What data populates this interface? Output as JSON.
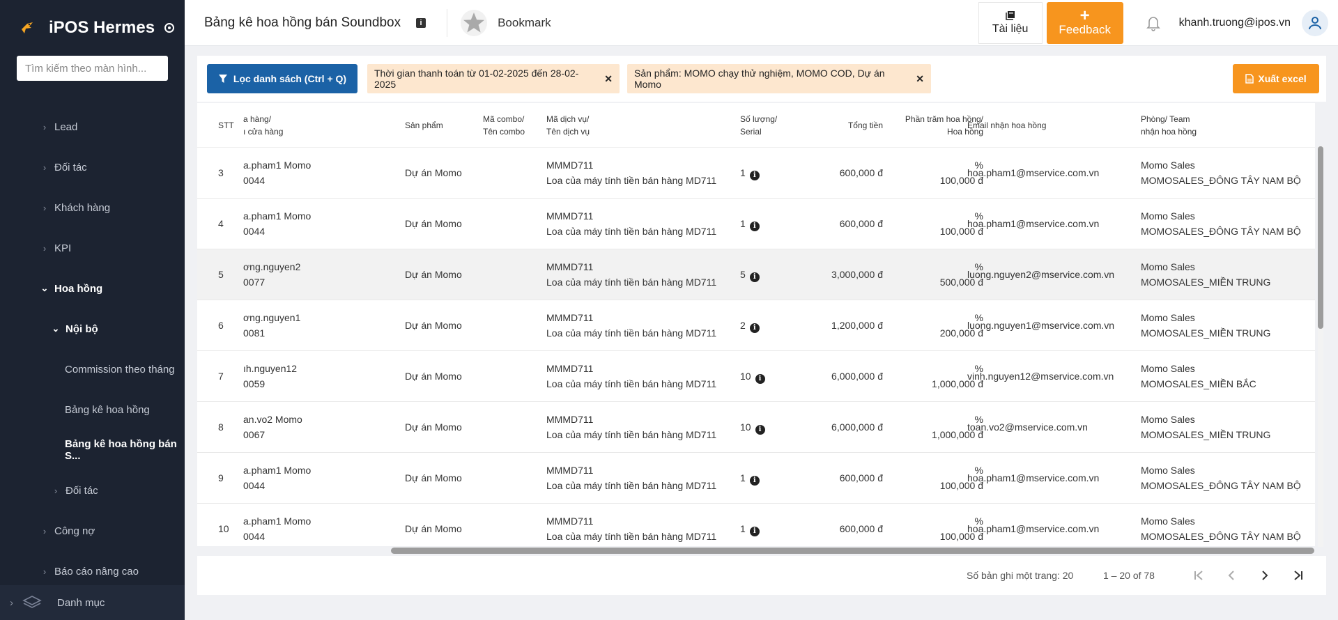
{
  "sidebar": {
    "app_name": "iPOS Hermes",
    "search_placeholder": "Tìm kiếm theo màn hình...",
    "items": [
      {
        "label": "Lead"
      },
      {
        "label": "Đối tác"
      },
      {
        "label": "Khách hàng"
      },
      {
        "label": "KPI"
      },
      {
        "label": "Hoa hồng"
      },
      {
        "label": "Nội bộ"
      },
      {
        "label": "Commission theo tháng"
      },
      {
        "label": "Bảng kê hoa hồng"
      },
      {
        "label": "Bảng kê hoa hồng bán S..."
      },
      {
        "label": "Đối tác"
      },
      {
        "label": "Công nợ"
      },
      {
        "label": "Báo cáo nâng cao"
      }
    ],
    "bottom_label": "Danh mục"
  },
  "header": {
    "title": "Bảng kê hoa hồng bán Soundbox",
    "bookmark_label": "Bookmark",
    "docs_label": "Tài liệu",
    "feedback_label": "Feedback",
    "user_email": "khanh.truong@ipos.vn"
  },
  "filters": {
    "filter_button": "Lọc danh sách (Ctrl + Q)",
    "chip_time": "Thời gian thanh toán từ 01-02-2025 đến 28-02-2025",
    "chip_product": "Sản phẩm: MOMO chạy thử nghiệm, MOMO COD, Dự án Momo",
    "export_button": "Xuất excel"
  },
  "table": {
    "headers": {
      "stt": "STT",
      "store_1": "a hàng/",
      "store_2": "ı cửa hàng",
      "product": "Sản phẩm",
      "combo_1": "Mã combo/",
      "combo_2": "Tên combo",
      "service_1": "Mã dịch vụ/",
      "service_2": "Tên dịch vụ",
      "qty_1": "Số lượng/",
      "qty_2": "Serial",
      "total": "Tổng tiền",
      "percent_1": "Phần trăm hoa hồng/",
      "percent_2": "Hoa hồng",
      "email": "Email nhận hoa hồng",
      "team_1": "Phòng/ Team",
      "team_2": "nhận hoa hồng"
    },
    "rows": [
      {
        "stt": "3",
        "store_1": "a.pham1 Momo",
        "store_2": "0044",
        "product": "Dự án Momo",
        "service_code": "MMMD711",
        "service_name": "Loa của máy tính tiền bán hàng MD711",
        "qty": "1",
        "total": "600,000 đ",
        "percent": "%",
        "commission": "100,000 đ",
        "email": "hoa.pham1@mservice.com.vn",
        "team_1": "Momo Sales",
        "team_2": "MOMOSALES_ĐÔNG TÂY NAM BỘ"
      },
      {
        "stt": "4",
        "store_1": "a.pham1 Momo",
        "store_2": "0044",
        "product": "Dự án Momo",
        "service_code": "MMMD711",
        "service_name": "Loa của máy tính tiền bán hàng MD711",
        "qty": "1",
        "total": "600,000 đ",
        "percent": "%",
        "commission": "100,000 đ",
        "email": "hoa.pham1@mservice.com.vn",
        "team_1": "Momo Sales",
        "team_2": "MOMOSALES_ĐÔNG TÂY NAM BỘ"
      },
      {
        "stt": "5",
        "store_1": "ơng.nguyen2",
        "store_2": "0077",
        "product": "Dự án Momo",
        "service_code": "MMMD711",
        "service_name": "Loa của máy tính tiền bán hàng MD711",
        "qty": "5",
        "total": "3,000,000 đ",
        "percent": "%",
        "commission": "500,000 đ",
        "email": "luong.nguyen2@mservice.com.vn",
        "team_1": "Momo Sales",
        "team_2": "MOMOSALES_MIỀN TRUNG"
      },
      {
        "stt": "6",
        "store_1": "ơng.nguyen1",
        "store_2": "0081",
        "product": "Dự án Momo",
        "service_code": "MMMD711",
        "service_name": "Loa của máy tính tiền bán hàng MD711",
        "qty": "2",
        "total": "1,200,000 đ",
        "percent": "%",
        "commission": "200,000 đ",
        "email": "luong.nguyen1@mservice.com.vn",
        "team_1": "Momo Sales",
        "team_2": "MOMOSALES_MIỀN TRUNG"
      },
      {
        "stt": "7",
        "store_1": "ıh.nguyen12",
        "store_2": "0059",
        "product": "Dự án Momo",
        "service_code": "MMMD711",
        "service_name": "Loa của máy tính tiền bán hàng MD711",
        "qty": "10",
        "total": "6,000,000 đ",
        "percent": "%",
        "commission": "1,000,000 đ",
        "email": "vinh.nguyen12@mservice.com.vn",
        "team_1": "Momo Sales",
        "team_2": "MOMOSALES_MIỀN BẮC"
      },
      {
        "stt": "8",
        "store_1": "an.vo2 Momo",
        "store_2": "0067",
        "product": "Dự án Momo",
        "service_code": "MMMD711",
        "service_name": "Loa của máy tính tiền bán hàng MD711",
        "qty": "10",
        "total": "6,000,000 đ",
        "percent": "%",
        "commission": "1,000,000 đ",
        "email": "toan.vo2@mservice.com.vn",
        "team_1": "Momo Sales",
        "team_2": "MOMOSALES_MIỀN TRUNG"
      },
      {
        "stt": "9",
        "store_1": "a.pham1 Momo",
        "store_2": "0044",
        "product": "Dự án Momo",
        "service_code": "MMMD711",
        "service_name": "Loa của máy tính tiền bán hàng MD711",
        "qty": "1",
        "total": "600,000 đ",
        "percent": "%",
        "commission": "100,000 đ",
        "email": "hoa.pham1@mservice.com.vn",
        "team_1": "Momo Sales",
        "team_2": "MOMOSALES_ĐÔNG TÂY NAM BỘ"
      },
      {
        "stt": "10",
        "store_1": "a.pham1 Momo",
        "store_2": "0044",
        "product": "Dự án Momo",
        "service_code": "MMMD711",
        "service_name": "Loa của máy tính tiền bán hàng MD711",
        "qty": "1",
        "total": "600,000 đ",
        "percent": "%",
        "commission": "100,000 đ",
        "email": "hoa.pham1@mservice.com.vn",
        "team_1": "Momo Sales",
        "team_2": "MOMOSALES_ĐÔNG TÂY NAM BỘ"
      }
    ]
  },
  "pagination": {
    "per_page": "Số bản ghi một trang: 20",
    "range": "1 – 20 of 78"
  },
  "colors": {
    "sidebar_bg": "#1c2331",
    "primary_blue": "#1b62a6",
    "accent_orange": "#f7951e",
    "chip_bg": "#fde7cf"
  }
}
